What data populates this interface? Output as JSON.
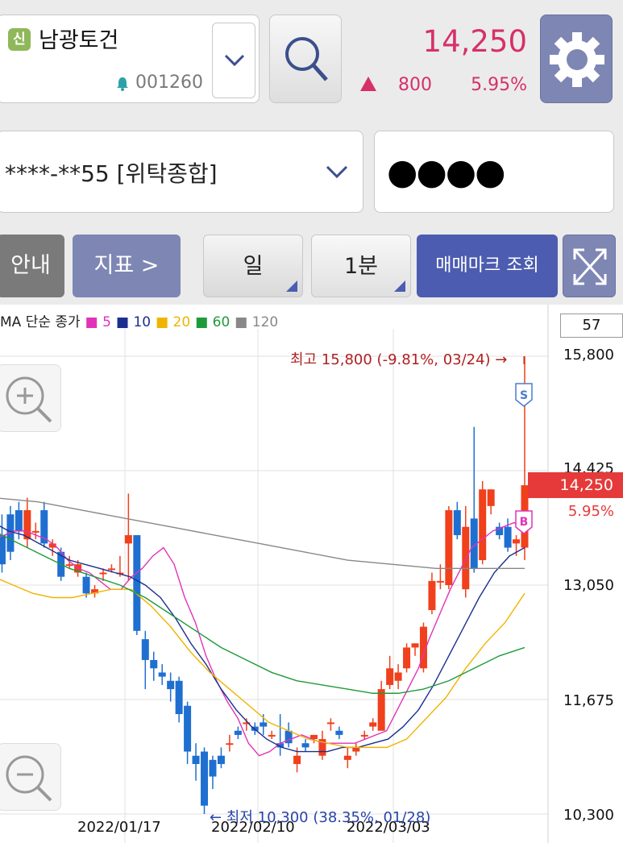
{
  "stock": {
    "badge": "신",
    "name": "남광토건",
    "code": "001260",
    "price": "14,250",
    "change": "800",
    "change_pct": "5.95%"
  },
  "account": {
    "number": "****-**55 [위탁종합]",
    "password_mask": "●●●●"
  },
  "toolbar": {
    "guide": "안내",
    "indicator": "지표 >",
    "period": "일",
    "interval": "1분",
    "trade_mark": "매매마크 조회"
  },
  "chart_legend": {
    "prefix": "MA 단순 종가",
    "ma": [
      {
        "label": "5",
        "color": "#e033b8"
      },
      {
        "label": "10",
        "color": "#1a2f8f"
      },
      {
        "label": "20",
        "color": "#f0b400"
      },
      {
        "label": "60",
        "color": "#1f9a3a"
      },
      {
        "label": "120",
        "color": "#888888"
      }
    ]
  },
  "candle_count": "57",
  "y_ticks": [
    "15,800",
    "14,425",
    "13,050",
    "11,675",
    "10,300"
  ],
  "x_ticks": [
    "2022/01/17",
    "2022/02/10",
    "2022/03/03"
  ],
  "high_label": "최고 15,800 (-9.81%, 03/24) →",
  "low_label": "← 최저 10,300 (38.35%, 01/28)",
  "current_tag": {
    "price": "14,250",
    "pct": "5.95%"
  },
  "markers": {
    "sell": "S",
    "buy": "B"
  },
  "chart_data": {
    "type": "candlestick",
    "ylim": [
      10300,
      15800
    ],
    "x_ticks": [
      "2022/01/17",
      "2022/02/10",
      "2022/03/03"
    ],
    "high": {
      "value": 15800,
      "date": "03/24",
      "pct": "-9.81%"
    },
    "low": {
      "value": 10300,
      "date": "01/28",
      "pct": "38.35%"
    },
    "last": 14250,
    "candles": [
      [
        13700,
        13550,
        13250,
        13800
      ],
      [
        13650,
        13300,
        13200,
        13900
      ],
      [
        13900,
        13450,
        13350,
        14000
      ],
      [
        13950,
        13700,
        13600,
        14050
      ],
      [
        13600,
        13950,
        13500,
        14100
      ],
      [
        13700,
        13700,
        13600,
        13800
      ],
      [
        13950,
        13550,
        13500,
        14050
      ],
      [
        13500,
        13550,
        13400,
        13600
      ],
      [
        13450,
        13150,
        13100,
        13500
      ],
      [
        13300,
        13300,
        13250,
        13400
      ],
      [
        13200,
        13300,
        13150,
        13350
      ],
      [
        13150,
        12950,
        12900,
        13200
      ],
      [
        12950,
        13000,
        12900,
        13050
      ],
      [
        13200,
        13200,
        13100,
        13250
      ],
      [
        13250,
        13250,
        13200,
        13300
      ],
      [
        13200,
        13200,
        13150,
        13400
      ],
      [
        13550,
        13650,
        13100,
        14150
      ],
      [
        13650,
        12500,
        12450,
        13650
      ],
      [
        12400,
        12150,
        11800,
        12500
      ],
      [
        12150,
        12050,
        11900,
        12250
      ],
      [
        12000,
        11950,
        11850,
        12100
      ],
      [
        11900,
        11800,
        11650,
        12000
      ],
      [
        11900,
        11500,
        11400,
        11950
      ],
      [
        11600,
        11050,
        10900,
        11650
      ],
      [
        11000,
        10900,
        10700,
        11150
      ],
      [
        11050,
        10400,
        10300,
        11100
      ],
      [
        10950,
        10750,
        10600,
        11000
      ],
      [
        11000,
        10900,
        10850,
        11100
      ],
      [
        11150,
        11150,
        11050,
        11250
      ],
      [
        11300,
        11250,
        11200,
        11350
      ],
      [
        11400,
        11400,
        11300,
        11450
      ],
      [
        11350,
        11300,
        11250,
        11400
      ],
      [
        11400,
        11350,
        11250,
        11500
      ],
      [
        11250,
        11250,
        11200,
        11300
      ],
      [
        11150,
        11100,
        11000,
        11500
      ],
      [
        11300,
        11150,
        11100,
        11400
      ],
      [
        10900,
        11000,
        10800,
        11100
      ],
      [
        11150,
        11100,
        11050,
        11200
      ],
      [
        11200,
        11250,
        11150,
        11250
      ],
      [
        11000,
        11200,
        10950,
        11300
      ],
      [
        11400,
        11400,
        11300,
        11450
      ],
      [
        11300,
        11250,
        11200,
        11350
      ],
      [
        10950,
        11000,
        10850,
        11100
      ],
      [
        11050,
        11100,
        11000,
        11150
      ],
      [
        11250,
        11250,
        11200,
        11300
      ],
      [
        11350,
        11400,
        11300,
        11450
      ],
      [
        11300,
        11800,
        11300,
        11900
      ],
      [
        11850,
        12050,
        11800,
        12200
      ],
      [
        11900,
        12000,
        11800,
        12100
      ],
      [
        12050,
        12300,
        12000,
        12350
      ],
      [
        12300,
        12350,
        12200,
        12350
      ],
      [
        12050,
        12550,
        12000,
        12600
      ],
      [
        12750,
        13100,
        12700,
        13200
      ],
      [
        13100,
        13100,
        13000,
        13300
      ],
      [
        13050,
        13950,
        13000,
        14000
      ],
      [
        13950,
        13650,
        13600,
        14050
      ],
      [
        13000,
        13750,
        12900,
        14000
      ],
      [
        13850,
        13250,
        13200,
        14950
      ],
      [
        13350,
        14200,
        13300,
        14300
      ],
      [
        14000,
        14200,
        13900,
        14200
      ],
      [
        13750,
        13650,
        13600,
        13800
      ],
      [
        13750,
        13500,
        13450,
        13850
      ],
      [
        13550,
        13600,
        13400,
        13650
      ],
      [
        13500,
        14250,
        13350,
        15800
      ]
    ],
    "series": [
      {
        "name": "5",
        "color": "#e033b8",
        "values": [
          13600,
          13650,
          13700,
          13700,
          13650,
          13600,
          13500,
          13350,
          13250,
          13200,
          13100,
          13000,
          13000,
          13150,
          13250,
          13400,
          13500,
          13300,
          12900,
          12600,
          12200,
          11900,
          11650,
          11450,
          11150,
          11000,
          11050,
          11150,
          11200,
          11250,
          11200,
          11150,
          11150,
          11150,
          11150,
          11200,
          11250,
          11300,
          11550,
          11800,
          12050,
          12400,
          12700,
          13000,
          13250,
          13500,
          13600,
          13700,
          13750,
          13800,
          13750
        ]
      },
      {
        "name": "10",
        "color": "#1a2f8f",
        "values": [
          13800,
          13700,
          13650,
          13550,
          13450,
          13350,
          13300,
          13250,
          13200,
          13150,
          13050,
          12900,
          12650,
          12350,
          12100,
          11800,
          11550,
          11350,
          11200,
          11100,
          11050,
          11050,
          11050,
          11100,
          11100,
          11150,
          11200,
          11350,
          11550,
          11850,
          12200,
          12550,
          12900,
          13200,
          13400,
          13500
        ]
      },
      {
        "name": "20",
        "color": "#f0b400",
        "values": [
          13150,
          13050,
          12950,
          12900,
          12900,
          12950,
          13000,
          13000,
          12800,
          12550,
          12250,
          12000,
          11800,
          11600,
          11400,
          11300,
          11200,
          11150,
          11100,
          11100,
          11100,
          11200,
          11450,
          11700,
          12050,
          12350,
          12600,
          12950
        ]
      },
      {
        "name": "60",
        "color": "#1f9a3a",
        "values": [
          13700,
          13550,
          13400,
          13250,
          13150,
          13050,
          12900,
          12700,
          12500,
          12300,
          12150,
          12000,
          11900,
          11850,
          11800,
          11750,
          11750,
          11800,
          11900,
          12050,
          12200,
          12300
        ]
      },
      {
        "name": "120",
        "color": "#888888",
        "values": [
          14100,
          14050,
          13950,
          13850,
          13750,
          13650,
          13550,
          13450,
          13350,
          13300,
          13250,
          13250,
          13250
        ]
      }
    ]
  }
}
